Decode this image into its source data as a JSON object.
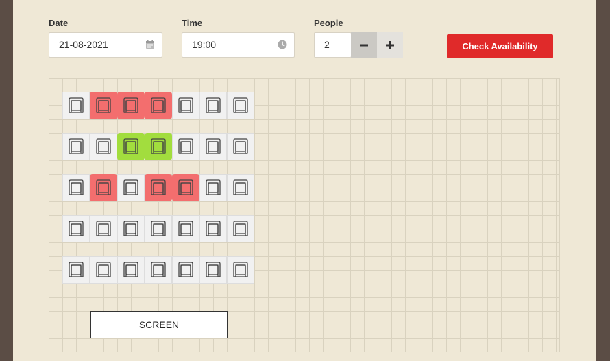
{
  "form": {
    "date": {
      "label": "Date",
      "value": "21-08-2021",
      "icon": "calendar-icon"
    },
    "time": {
      "label": "Time",
      "value": "19:00",
      "icon": "clock-icon"
    },
    "people": {
      "label": "People",
      "value": "2",
      "decrement_icon": "minus-icon",
      "increment_icon": "plus-icon"
    },
    "check_button": "Check Availability"
  },
  "colors": {
    "available": "#f1f1f1",
    "booked": "#f36e6e",
    "selected": "#a2dd3e",
    "accent": "#e02a2a"
  },
  "seat_map": {
    "rows": [
      [
        "available",
        "booked",
        "booked",
        "booked",
        "available",
        "available",
        "available"
      ],
      [
        "available",
        "available",
        "selected",
        "selected",
        "available",
        "available",
        "available"
      ],
      [
        "available",
        "booked",
        "available",
        "booked",
        "booked",
        "available",
        "available"
      ],
      [
        "available",
        "available",
        "available",
        "available",
        "available",
        "available",
        "available"
      ],
      [
        "available",
        "available",
        "available",
        "available",
        "available",
        "available",
        "available"
      ]
    ],
    "screen_label": "SCREEN"
  }
}
